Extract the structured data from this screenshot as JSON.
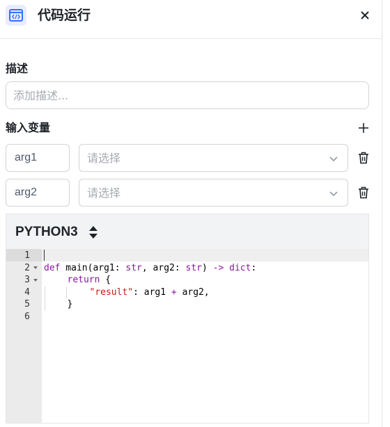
{
  "header": {
    "title": "代码运行",
    "icon": "code-window-icon",
    "close_icon": "close-icon"
  },
  "description": {
    "label": "描述",
    "placeholder": "添加描述..."
  },
  "inputs": {
    "label": "输入变量",
    "add_icon": "plus-icon",
    "rows": [
      {
        "name": "arg1",
        "select_placeholder": "请选择"
      },
      {
        "name": "arg2",
        "select_placeholder": "请选择"
      }
    ]
  },
  "editor": {
    "language": "PYTHON3",
    "line_numbers": [
      "1",
      "2",
      "3",
      "4",
      "5",
      "6"
    ],
    "lines": {
      "l2": {
        "def": "def",
        "name": " main(arg1: ",
        "t1": "str",
        "mid": ", arg2: ",
        "t2": "str",
        "close": ") ",
        "arrow": "->",
        "sp": " ",
        "ret": "dict",
        "colon": ":"
      },
      "l3": {
        "kw": "return",
        "rest": " {"
      },
      "l4": {
        "key": "\"result\"",
        "colon": ": arg1 ",
        "plus": "+",
        "rest": " arg2,"
      },
      "l5": {
        "text": "}"
      }
    }
  },
  "colors": {
    "accent": "#3370ff",
    "keyword": "#8a16a1",
    "string": "#c41a16"
  }
}
